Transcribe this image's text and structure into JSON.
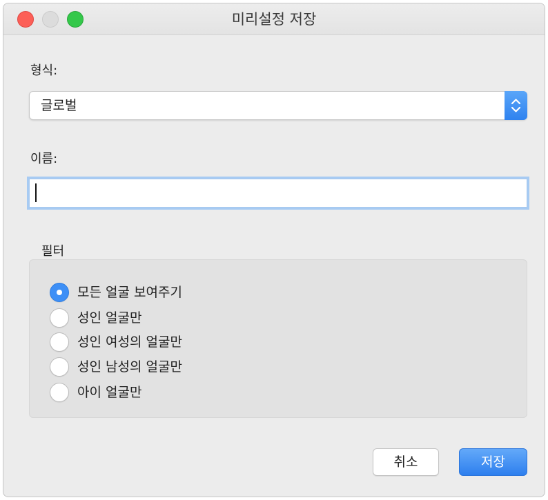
{
  "window": {
    "title": "미리설정 저장"
  },
  "format": {
    "label": "형식:",
    "selected": "글로벌"
  },
  "name": {
    "label": "이름:",
    "value": ""
  },
  "filter": {
    "label": "필터",
    "options": [
      {
        "label": "모든 얼굴 보여주기",
        "selected": true
      },
      {
        "label": "성인 얼굴만",
        "selected": false
      },
      {
        "label": "성인 여성의 얼굴만",
        "selected": false
      },
      {
        "label": "성인 남성의 얼굴만",
        "selected": false
      },
      {
        "label": "아이 얼굴만",
        "selected": false
      }
    ]
  },
  "buttons": {
    "cancel": "취소",
    "save": "저장"
  },
  "colors": {
    "accent": "#3d8ff6",
    "close": "#fc5f57",
    "zoom": "#34c84a",
    "panel": "#ececec"
  },
  "icons": {
    "select_arrow": "up-down-chevron-icon"
  }
}
